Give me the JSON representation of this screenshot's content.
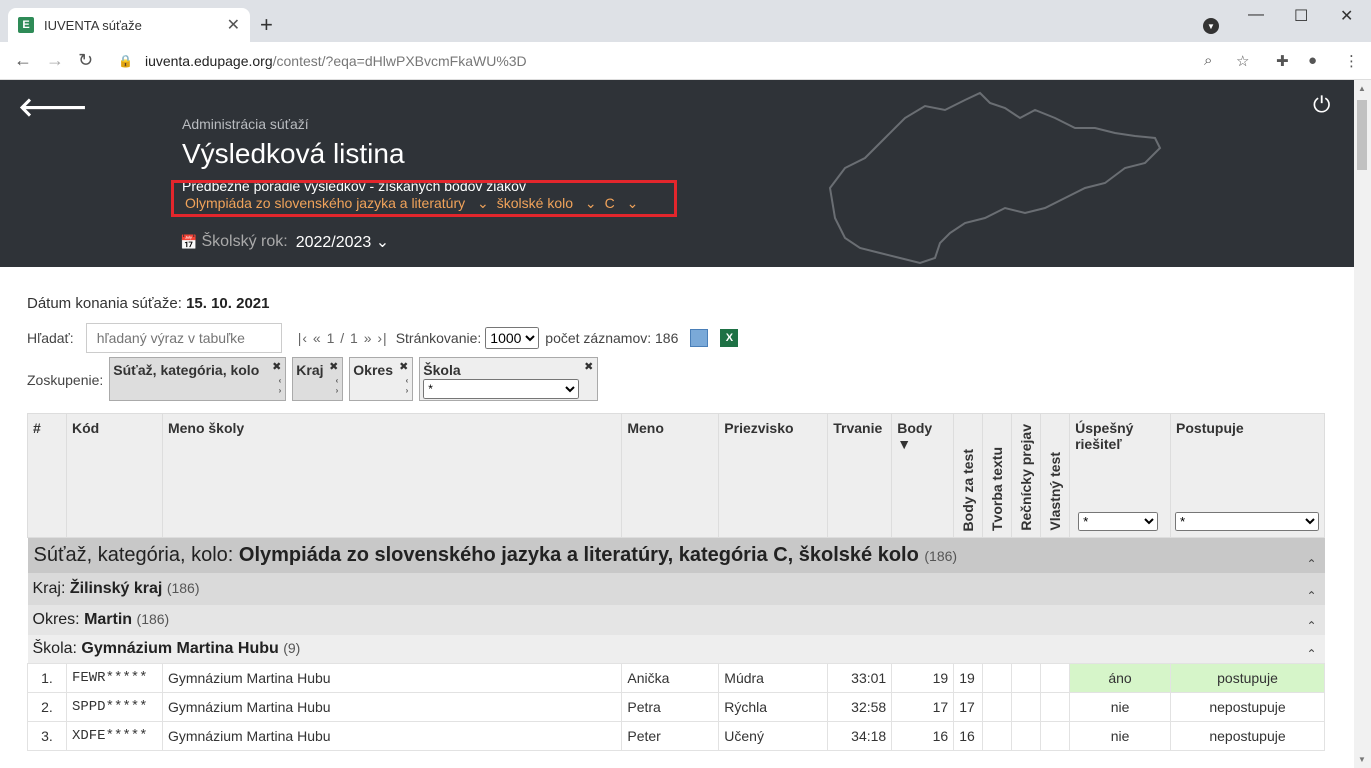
{
  "browser": {
    "tab_title": "IUVENTA súťaže",
    "favicon_letter": "E",
    "new_tab_symbol": "+",
    "url_host": "iuventa.edupage.org",
    "url_path": "/contest/?eqa=dHlwPXBvcmFkaWU%3D"
  },
  "header": {
    "subtitle": "Administrácia súťaží",
    "title": "Výsledková listina",
    "description": "Predbežné poradie výsledkov - získaných bodov žiakov",
    "filter_competition": "Olympiáda zo slovenského jazyka a literatúry",
    "filter_round": "školské kolo",
    "filter_category": "C",
    "year_label": "Školský rok:",
    "year_value": "2022/2023"
  },
  "toolbar": {
    "date_label": "Dátum konania súťaže:",
    "date_value": "15. 10. 2021",
    "search_label": "Hľadať:",
    "search_placeholder": "hľadaný výraz v tabuľke",
    "pager": "|‹ « 1 / 1 » ›|",
    "paging_label": "Stránkovanie:",
    "paging_value": "1000",
    "count_label": "počet záznamov: 186",
    "xls_letter": "X"
  },
  "grouping": {
    "label": "Zoskupenie:",
    "chips": [
      "Súťaž, kategória, kolo",
      "Kraj",
      "Okres",
      "Škola"
    ],
    "school_select": "*"
  },
  "table": {
    "headers": {
      "num": "#",
      "code": "Kód",
      "school": "Meno školy",
      "first": "Meno",
      "last": "Priezvisko",
      "duration": "Trvanie",
      "points": "Body",
      "sort_indicator": "▼",
      "v1": "Body za test",
      "v2": "Tvorba textu",
      "v3": "Rečnícky prejav",
      "v4": "Vlastný test",
      "success": "Úspešný riešiteľ",
      "advance": "Postupuje",
      "success_filter": "*",
      "advance_filter": "*"
    },
    "group1": {
      "label": "Súťaž, kategória, kolo:",
      "value": "Olympiáda zo slovenského jazyka a literatúry, kategória C, školské kolo",
      "count": "(186)"
    },
    "group2": {
      "label": "Kraj:",
      "value": "Žilinský kraj",
      "count": "(186)"
    },
    "group3": {
      "label": "Okres:",
      "value": "Martin",
      "count": "(186)"
    },
    "group4": {
      "label": "Škola:",
      "value": "Gymnázium Martina Hubu",
      "count": "(9)"
    },
    "rows": [
      {
        "num": "1.",
        "code": "FEWR*****",
        "school": "Gymnázium Martina Hubu",
        "first": "Anička",
        "last": "Múdra",
        "duration": "33:01",
        "points": "19",
        "v1": "19",
        "success": "áno",
        "advance": "postupuje"
      },
      {
        "num": "2.",
        "code": "SPPD*****",
        "school": "Gymnázium Martina Hubu",
        "first": "Petra",
        "last": "Rýchla",
        "duration": "32:58",
        "points": "17",
        "v1": "17",
        "success": "nie",
        "advance": "nepostupuje"
      },
      {
        "num": "3.",
        "code": "XDFE*****",
        "school": "Gymnázium Martina Hubu",
        "first": "Peter",
        "last": "Učený",
        "duration": "34:18",
        "points": "16",
        "v1": "16",
        "success": "nie",
        "advance": "nepostupuje"
      }
    ]
  }
}
